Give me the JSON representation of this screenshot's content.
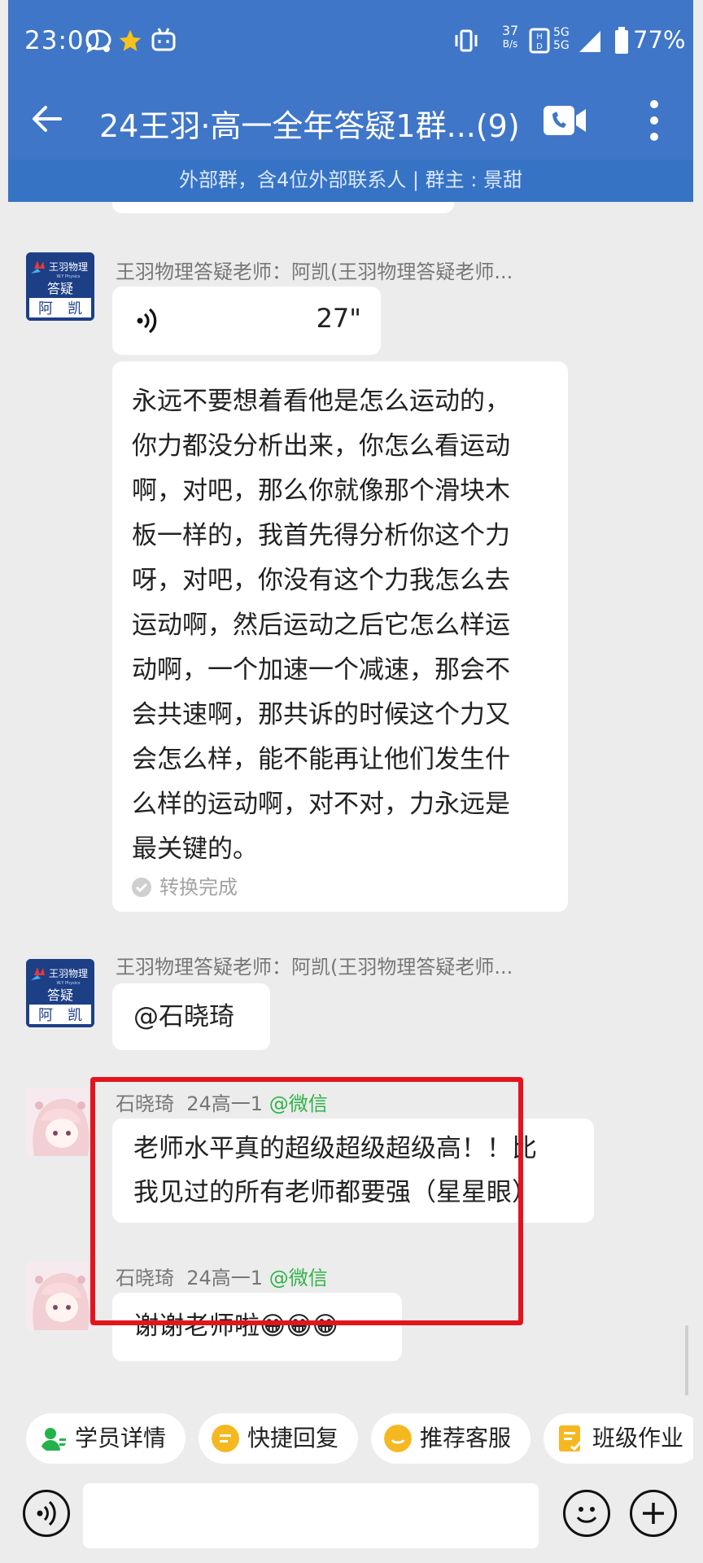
{
  "status_bar": {
    "time": "23:00",
    "net_speed_value": "37",
    "net_speed_unit": "B/s",
    "sim1": "5G",
    "sim2": "5G",
    "battery": "77%"
  },
  "header": {
    "back_icon": "arrow-left-icon",
    "title": "24王羽·高一全年答疑1群...(9)",
    "call_icon": "video-call-icon",
    "more_icon": "more-vertical-icon",
    "subtitle": "外部群，含4位外部联系人 | 群主 : 景甜"
  },
  "avatars": {
    "teacher": {
      "line1": "王羽物理",
      "line2": "W.Y Physics",
      "line3": "答疑",
      "line4": "阿　凯"
    }
  },
  "messages": [
    {
      "sender": "王羽物理答疑老师：阿凯(王羽物理答疑老师...",
      "voice_duration": "27\""
    },
    {
      "transcript_lines": [
        "永远不要想着看他是怎么运动的，",
        "你力都没分析出来，你怎么看运动",
        "啊，对吧，那么你就像那个滑块木",
        "板一样的，我首先得分析你这个力",
        "呀，对吧，你没有这个力我怎么去",
        "运动啊，然后运动之后它怎么样运",
        "动啊，一个加速一个减速，那会不",
        "会共速啊，那共诉的时候这个力又",
        "会怎么样，能不能再让他们发生什",
        "么样的运动啊，对不对，力永远是",
        "最关键的。"
      ],
      "status": "转换完成"
    },
    {
      "sender": "王羽物理答疑老师：阿凯(王羽物理答疑老师...",
      "text": "@石晓琦"
    },
    {
      "sender": "石晓琦",
      "class": "24高一1",
      "source": "@微信",
      "lines": [
        "老师水平真的超级超级超级高！！比",
        "我见过的所有老师都要强（星星眼）"
      ]
    },
    {
      "sender": "石晓琦",
      "class": "24高一1",
      "source": "@微信",
      "text": "谢谢老师啦😁😁😁"
    }
  ],
  "quick_actions": [
    {
      "label": "学员详情",
      "icon": "user-detail-icon",
      "color": "#26b24b"
    },
    {
      "label": "快捷回复",
      "icon": "quick-reply-icon",
      "color": "#f5b821"
    },
    {
      "label": "推荐客服",
      "icon": "service-icon",
      "color": "#f5b821"
    },
    {
      "label": "班级作业",
      "icon": "homework-icon",
      "color": "#f5b821"
    }
  ],
  "input_bar": {
    "voice_icon": "voice-input-icon",
    "emoji_icon": "emoji-icon",
    "plus_icon": "plus-icon"
  },
  "colors": {
    "header": "#3f76c8",
    "highlight_box": "#e4141e",
    "wechat_green": "#2fb34a"
  }
}
